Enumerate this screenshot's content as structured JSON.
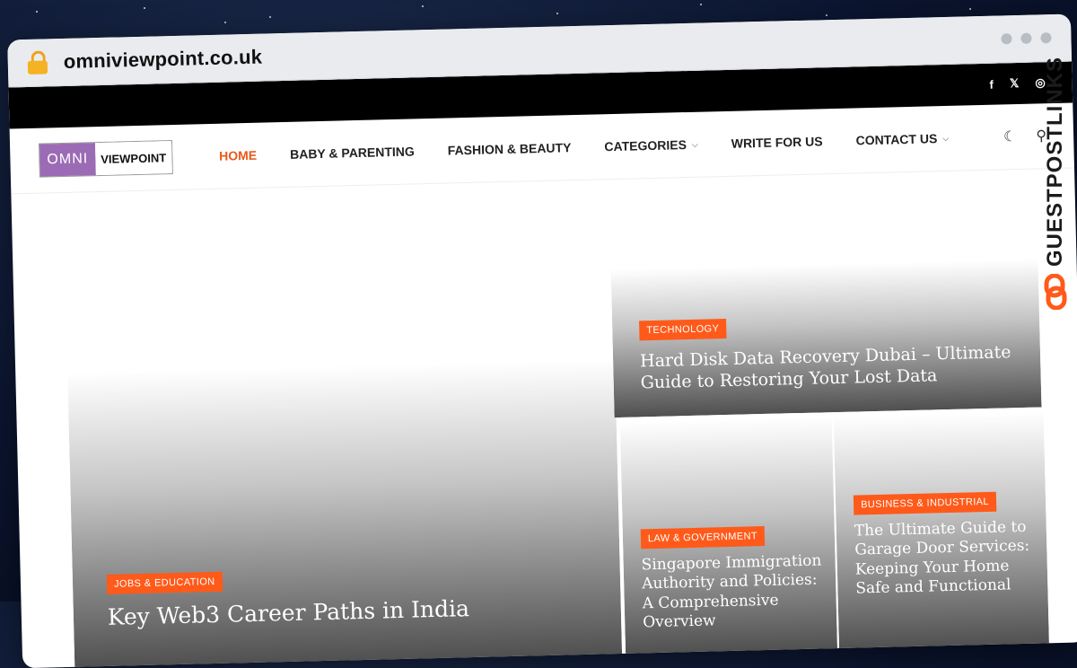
{
  "browser": {
    "url": "omniviewpoint.co.uk"
  },
  "social": [
    "f",
    "𝕏",
    "◎"
  ],
  "header": {
    "logo_left": "OMNI",
    "logo_right": "VIEWPOINT",
    "menu": [
      {
        "label": "HOME",
        "active": true
      },
      {
        "label": "BABY & PARENTING"
      },
      {
        "label": "FASHION & BEAUTY"
      },
      {
        "label": "CATEGORIES",
        "dropdown": true
      },
      {
        "label": "WRITE FOR US"
      },
      {
        "label": "CONTACT US",
        "dropdown": true
      }
    ]
  },
  "posts": {
    "main": {
      "category": "JOBS & EDUCATION",
      "title": "Key Web3 Career Paths in India"
    },
    "top_right": {
      "category": "TECHNOLOGY",
      "title": "Hard Disk Data Recovery Dubai – Ultimate Guide to Restoring Your Lost Data"
    },
    "bottom_left": {
      "category": "LAW & GOVERNMENT",
      "title": "Singapore Immigration Authority and Policies: A Comprehensive Overview"
    },
    "bottom_right": {
      "category": "BUSINESS & INDUSTRIAL",
      "title": "The Ultimate Guide to Garage Door Services: Keeping Your Home Safe and Functional"
    }
  },
  "watermark": {
    "text": "GUESTPOSTLINKS"
  },
  "colors": {
    "accent": "#e85b1d",
    "badge": "#ff5a1a",
    "logo_purple": "#9b6bb5"
  }
}
